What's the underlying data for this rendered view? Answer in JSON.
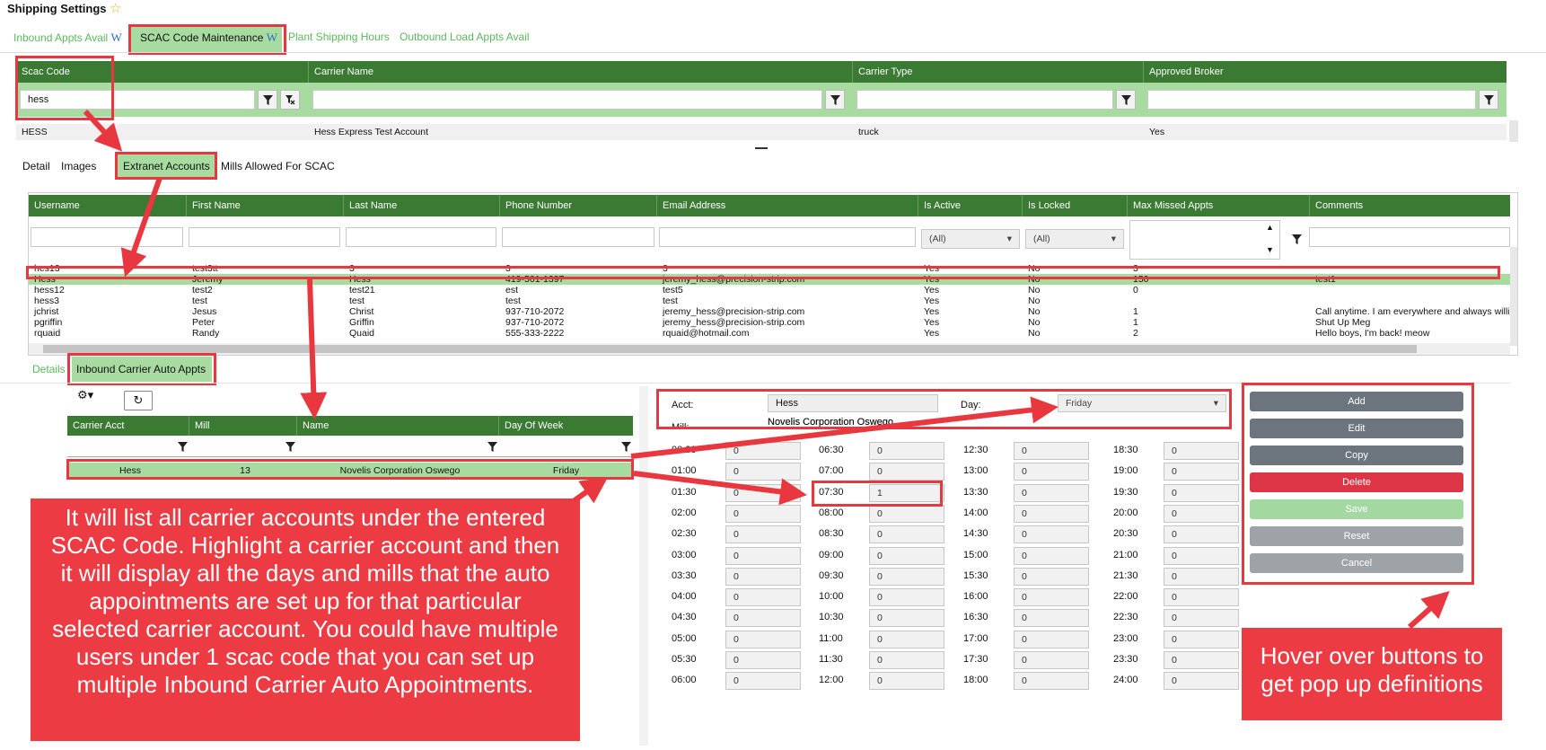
{
  "page": {
    "title": "Shipping Settings"
  },
  "top_tabs": [
    {
      "label": "Inbound Appts Avail",
      "w": "W"
    },
    {
      "label": "SCAC Code Maintenance",
      "w": "W"
    },
    {
      "label": "Plant Shipping Hours"
    },
    {
      "label": "Outbound Load Appts Avail"
    }
  ],
  "scac_grid": {
    "headers": [
      "Scac Code",
      "Carrier Name",
      "Carrier Type",
      "Approved Broker"
    ],
    "filter": "hess",
    "row": [
      "HESS",
      "Hess Express Test Account",
      "truck",
      "Yes"
    ]
  },
  "sub_tabs": [
    "Detail",
    "Images",
    "Extranet Accounts",
    "Mills Allowed For SCAC"
  ],
  "accounts_grid": {
    "headers": [
      "Username",
      "First Name",
      "Last Name",
      "Phone Number",
      "Email Address",
      "Is Active",
      "Is Locked",
      "Max Missed Appts",
      "Comments"
    ],
    "all_label": "(All)",
    "rows": [
      [
        "hes13",
        "test3tt",
        "3",
        "3",
        "3",
        "Yes",
        "No",
        "3",
        ""
      ],
      [
        "Hess",
        "Jeremy",
        "Hess",
        "419-501-1397",
        "jeremy_hess@precision-strip.com",
        "Yes",
        "No",
        "150",
        "test1"
      ],
      [
        "hess12",
        "test2",
        "test21",
        "est",
        "test5",
        "Yes",
        "No",
        "0",
        ""
      ],
      [
        "hess3",
        "test",
        "test",
        "test",
        "test",
        "Yes",
        "No",
        "",
        ""
      ],
      [
        "jchrist",
        "Jesus",
        "Christ",
        "937-710-2072",
        "jeremy_hess@precision-strip.com",
        "Yes",
        "No",
        "1",
        "Call anytime. I am everywhere and always willi"
      ],
      [
        "pgriffin",
        "Peter",
        "Griffin",
        "937-710-2072",
        "jeremy_hess@precision-strip.com",
        "Yes",
        "No",
        "1",
        "Shut Up Meg"
      ],
      [
        "rquaid",
        "Randy",
        "Quaid",
        "555-333-2222",
        "rquaid@hotmail.com",
        "Yes",
        "No",
        "2",
        "Hello boys, I'm back! meow"
      ]
    ]
  },
  "lower_tabs": [
    "Details",
    "Inbound Carrier Auto Appts"
  ],
  "auto_grid": {
    "headers": [
      "Carrier Acct",
      "Mill",
      "Name",
      "Day Of Week"
    ],
    "row": [
      "Hess",
      "13",
      "Novelis Corporation Oswego",
      "Friday"
    ]
  },
  "detail_form": {
    "acct_label": "Acct:",
    "acct_value": "Hess",
    "day_label": "Day:",
    "day_value": "Friday",
    "mill_label": "Mill:",
    "mill_value": "Novelis Corporation Oswego"
  },
  "time_slots": [
    [
      "00:30",
      "0"
    ],
    [
      "01:00",
      "0"
    ],
    [
      "01:30",
      "0"
    ],
    [
      "02:00",
      "0"
    ],
    [
      "02:30",
      "0"
    ],
    [
      "03:00",
      "0"
    ],
    [
      "03:30",
      "0"
    ],
    [
      "04:00",
      "0"
    ],
    [
      "04:30",
      "0"
    ],
    [
      "05:00",
      "0"
    ],
    [
      "05:30",
      "0"
    ],
    [
      "06:00",
      "0"
    ],
    [
      "06:30",
      "0"
    ],
    [
      "07:00",
      "0"
    ],
    [
      "07:30",
      "1"
    ],
    [
      "08:00",
      "0"
    ],
    [
      "08:30",
      "0"
    ],
    [
      "09:00",
      "0"
    ],
    [
      "09:30",
      "0"
    ],
    [
      "10:00",
      "0"
    ],
    [
      "10:30",
      "0"
    ],
    [
      "11:00",
      "0"
    ],
    [
      "11:30",
      "0"
    ],
    [
      "12:00",
      "0"
    ],
    [
      "12:30",
      "0"
    ],
    [
      "13:00",
      "0"
    ],
    [
      "13:30",
      "0"
    ],
    [
      "14:00",
      "0"
    ],
    [
      "14:30",
      "0"
    ],
    [
      "15:00",
      "0"
    ],
    [
      "15:30",
      "0"
    ],
    [
      "16:00",
      "0"
    ],
    [
      "16:30",
      "0"
    ],
    [
      "17:00",
      "0"
    ],
    [
      "17:30",
      "0"
    ],
    [
      "18:00",
      "0"
    ],
    [
      "18:30",
      "0"
    ],
    [
      "19:00",
      "0"
    ],
    [
      "19:30",
      "0"
    ],
    [
      "20:00",
      "0"
    ],
    [
      "20:30",
      "0"
    ],
    [
      "21:00",
      "0"
    ],
    [
      "21:30",
      "0"
    ],
    [
      "22:00",
      "0"
    ],
    [
      "22:30",
      "0"
    ],
    [
      "23:00",
      "0"
    ],
    [
      "23:30",
      "0"
    ],
    [
      "24:00",
      "0"
    ]
  ],
  "buttons": [
    {
      "label": "Add",
      "color": "#6c757d"
    },
    {
      "label": "Edit",
      "color": "#6c757d"
    },
    {
      "label": "Copy",
      "color": "#6c757d"
    },
    {
      "label": "Delete",
      "color": "#dc3545"
    },
    {
      "label": "Save",
      "color": "#a3d9a0"
    },
    {
      "label": "Reset",
      "color": "#9ea3a8"
    },
    {
      "label": "Cancel",
      "color": "#9ea3a8"
    }
  ],
  "callouts": {
    "left": "It will list all carrier accounts under the entered SCAC Code. Highlight a carrier account and then it will display all the days and mills that the auto appointments are set up for that particular selected carrier account. You could have multiple users under 1 scac code that you can set up multiple Inbound Carrier Auto Appointments.",
    "right": "Hover over buttons to get pop up definitions"
  },
  "colors": {
    "header_green": "#3a7a33",
    "filter_green": "#a7dba0",
    "annotation_red": "#e8373f"
  }
}
